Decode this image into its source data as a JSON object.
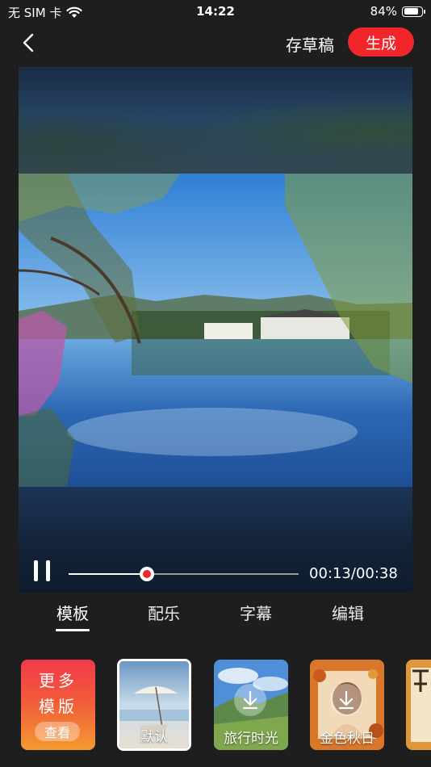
{
  "status_bar": {
    "carrier": "无 SIM 卡",
    "time": "14:22",
    "battery_percent": "84%",
    "battery_level": 0.84
  },
  "header": {
    "back_icon": "chevron-left-icon",
    "draft_label": "存草稿",
    "generate_label": "生成",
    "accent_color": "#f0262b"
  },
  "player": {
    "paused_icon": "pause-icon",
    "timecode": "00:13/00:38",
    "progress": 0.34
  },
  "tabs": [
    {
      "label": "模板",
      "active": true
    },
    {
      "label": "配乐",
      "active": false
    },
    {
      "label": "字幕",
      "active": false
    },
    {
      "label": "编辑",
      "active": false
    }
  ],
  "templates": {
    "more": {
      "line1": "更多",
      "line2": "模版",
      "view_label": "查看"
    },
    "items": [
      {
        "label": "默认",
        "selected": true
      },
      {
        "label": "旅行时光",
        "selected": false,
        "icon": "download-icon"
      },
      {
        "label": "金色秋日",
        "selected": false,
        "icon": "download-icon"
      }
    ]
  }
}
